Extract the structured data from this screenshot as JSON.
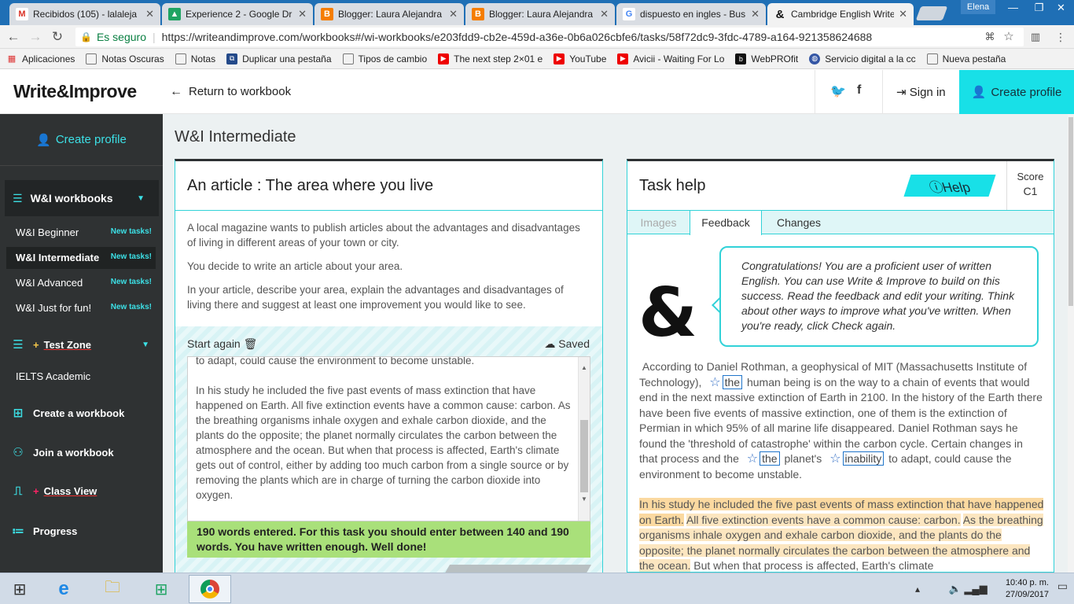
{
  "browser": {
    "tabs": [
      {
        "label": "Recibidos (105) - lalaleja",
        "icon": "gmail-icon",
        "color": "#d93025"
      },
      {
        "label": "Experience 2 - Google Dr",
        "icon": "drive-icon",
        "color": "#1fa463"
      },
      {
        "label": "Blogger: Laura Alejandra",
        "icon": "blogger-icon",
        "color": "#f57d00"
      },
      {
        "label": "Blogger: Laura Alejandra",
        "icon": "blogger-icon",
        "color": "#f57d00"
      },
      {
        "label": "dispuesto en ingles - Bus",
        "icon": "google-icon",
        "color": "#4285f4"
      },
      {
        "label": "Cambridge English Write",
        "icon": "ampersand-icon",
        "color": "#111111"
      }
    ],
    "user": "Elena",
    "secure_label": "Es seguro",
    "url": "https://writeandimprove.com/workbooks#/wi-workbooks/e203fdd9-cb2e-459d-a36e-0b6a026cbfe6/tasks/58f72dc9-3fdc-4789-a164-921358624688",
    "bookmarks": [
      {
        "label": "Aplicaciones",
        "icon": "apps-grid-icon"
      },
      {
        "label": "Notas Oscuras",
        "icon": "page-icon"
      },
      {
        "label": "Notas",
        "icon": "page-icon"
      },
      {
        "label": "Duplicar una pestaña",
        "icon": "duplicate-icon"
      },
      {
        "label": "Tipos de cambio",
        "icon": "page-icon"
      },
      {
        "label": "The next step 2×01 e",
        "icon": "youtube-icon"
      },
      {
        "label": "YouTube",
        "icon": "youtube-icon"
      },
      {
        "label": "Avicii - Waiting For Lo",
        "icon": "youtube-icon"
      },
      {
        "label": "WebPROfit",
        "icon": "webprofit-icon"
      },
      {
        "label": "Servicio digital a la cc",
        "icon": "globe-icon"
      },
      {
        "label": "Nueva pestaña",
        "icon": "page-icon"
      }
    ]
  },
  "site": {
    "logo": "Write&Improve",
    "return_link": "Return to workbook",
    "sign_in": "Sign in",
    "create_profile": "Create profile",
    "accent": "#18e0e7"
  },
  "sidebar": {
    "create_profile": "Create profile",
    "workbooks_label": "W&I workbooks",
    "items": [
      {
        "label": "W&I Beginner",
        "badge": "New tasks!"
      },
      {
        "label": "W&I Intermediate",
        "badge": "New tasks!"
      },
      {
        "label": "W&I Advanced",
        "badge": "New tasks!"
      },
      {
        "label": "W&I Just for fun!",
        "badge": "New tasks!"
      }
    ],
    "test_zone": "Test Zone",
    "ielts": "IELTS Academic",
    "create_workbook": "Create a workbook",
    "join_workbook": "Join a workbook",
    "class_view": "Class View",
    "progress": "Progress"
  },
  "main": {
    "title": "W&I Intermediate",
    "task": {
      "title": "An article : The area where you live",
      "desc": [
        "A local magazine wants to publish articles about the advantages and disadvantages of living in different areas of your town or city.",
        "You decide to write an article about your area.",
        "In your article, describe your area, explain the advantages and disadvantages of living there and suggest at least one improvement you would like to see."
      ],
      "start_again": "Start again",
      "saved": "Saved",
      "text_top": "to adapt, could cause the environment to become unstable.",
      "text_body": "In his study he included the five past events of mass extinction that have happened on Earth. All five extinction events have a common cause: carbon. As the breathing organisms inhale oxygen and exhale carbon dioxide, and the plants do the opposite; the planet normally circulates the carbon between the atmosphere and the ocean. But when that process is affected, Earth's climate gets out of control, either by adding too much carbon from a single source or by removing the plants which are in charge of turning the carbon dioxide into oxygen.",
      "word_count": "190 words entered. For this task you should enter between 140 and 190 words. You have written enough. Well done!"
    },
    "help": {
      "title": "Task help",
      "help_button": "Help",
      "score_label": "Score",
      "score": "C1",
      "tabs": [
        "Images",
        "Feedback",
        "Changes"
      ],
      "bubble": "Congratulations! You are a proficient user of written English. You can use Write & Improve to build on this success. Read the feedback and edit your writing. Think about other ways to improve what you've written. When you're ready, click Check again.",
      "amp_logo": "&",
      "p1_a": "According to Daniel Rothman, a geophysical of MIT (Massachusetts Institute of Technology),",
      "p1_w1": "the",
      "p1_b": "human being is on the way to a chain of events that would end in the next massive extinction of Earth in 2100. In the history of the Earth there have been five events of massive extinction, one of them is the extinction of Permian in which 95% of all marine life disappeared. Daniel Rothman says he found the 'threshold of catastrophe' within the carbon cycle. Certain changes in that process and the",
      "p1_w2": "the",
      "p1_c": "planet's",
      "p1_w3": "inability",
      "p1_d": "to adapt, could cause the environment to become unstable.",
      "p2_a": "In his study he included the five past events of mass extinction that have happened on Earth.",
      "p2_b": "All five extinction events have a common cause: carbon.",
      "p2_c": "As the breathing organisms inhale oxygen and exhale carbon dioxide, and the plants do the opposite; the planet normally circulates the carbon between the atmosphere and the ocean.",
      "p2_d": "But when that process is affected, Earth's climate"
    }
  },
  "taskbar": {
    "time": "10:40 p. m.",
    "date": "27/09/2017"
  }
}
